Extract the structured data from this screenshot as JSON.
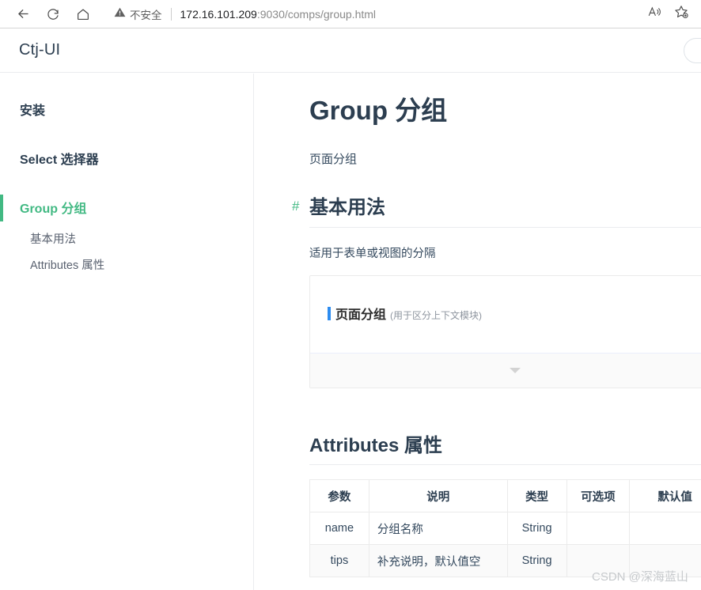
{
  "browser": {
    "back_icon": "back-arrow-icon",
    "reload_icon": "reload-icon",
    "home_icon": "home-icon",
    "security_label": "不安全",
    "security_icon": "warning-triangle-icon",
    "url_host": "172.16.101.209",
    "url_rest": ":9030/comps/group.html",
    "url_full": "172.16.101.209:9030/comps/group.html",
    "read_aloud_icon": "read-aloud-icon",
    "favorites_icon": "add-favorite-star-icon"
  },
  "header": {
    "brand": "Ctj-UI",
    "search_icon": "search-icon"
  },
  "sidebar": {
    "items": [
      {
        "label": "安装",
        "active": false
      },
      {
        "label": "Select 选择器",
        "active": false
      },
      {
        "label": "Group 分组",
        "active": true
      }
    ],
    "sub_items": [
      {
        "label": "基本用法"
      },
      {
        "label": "Attributes 属性"
      }
    ]
  },
  "main": {
    "title": "Group 分组",
    "description": "页面分组",
    "section": {
      "anchor": "#",
      "heading": "基本用法",
      "description": "适用于表单或视图的分隔"
    },
    "demo": {
      "group_name": "页面分组",
      "group_tips": "(用于区分上下文模块)",
      "expand_icon": "chevron-down-icon"
    },
    "attributes": {
      "heading": "Attributes 属性",
      "columns": [
        "参数",
        "说明",
        "类型",
        "可选项",
        "默认值"
      ],
      "rows": [
        {
          "param": "name",
          "desc": "分组名称",
          "type": "String",
          "options": "",
          "default": ""
        },
        {
          "param": "tips",
          "desc": "补充说明，默认值空",
          "type": "String",
          "options": "",
          "default": ""
        }
      ]
    }
  },
  "watermark": "CSDN @深海蓝山",
  "colors": {
    "accent_green": "#42b983",
    "brand_navy": "#2c3e50",
    "demo_blue": "#2d8cf0",
    "border": "#eaecef"
  }
}
